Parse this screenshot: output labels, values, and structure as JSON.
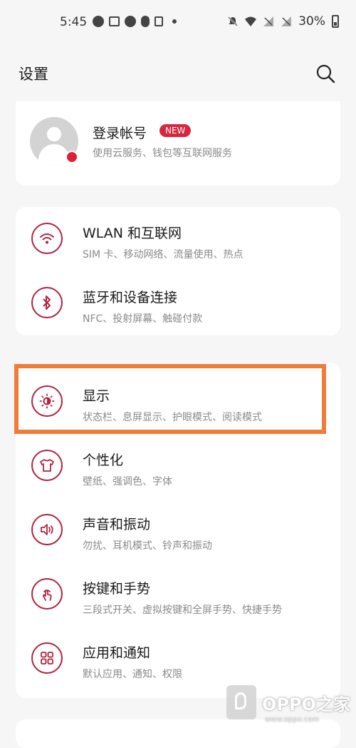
{
  "status_bar": {
    "time": "5:45",
    "battery": "30%",
    "icons": [
      "notification-icon",
      "image-icon",
      "notification-icon",
      "shield-icon",
      "copy-icon",
      "dot-icon",
      "mute-icon",
      "wifi-icon",
      "signal-off-icon",
      "signal-off-icon"
    ]
  },
  "header": {
    "title": "设置",
    "search_icon": "search-icon"
  },
  "account": {
    "title": "登录帐号",
    "badge": "NEW",
    "subtitle": "使用云服务、钱包等互联网服务"
  },
  "network_items": [
    {
      "title": "WLAN 和互联网",
      "subtitle": "SIM 卡、移动网络、流量使用、热点",
      "icon": "wifi-icon"
    },
    {
      "title": "蓝牙和设备连接",
      "subtitle": "NFC、投射屏幕、触碰付款",
      "icon": "bluetooth-icon"
    }
  ],
  "main_items": [
    {
      "title": "显示",
      "subtitle": "状态栏、息屏显示、护眼模式、阅读模式",
      "icon": "brightness-icon"
    },
    {
      "title": "个性化",
      "subtitle": "壁纸、强调色、字体",
      "icon": "tshirt-icon"
    },
    {
      "title": "声音和振动",
      "subtitle": "勿扰、耳机模式、铃声和振动",
      "icon": "speaker-icon"
    },
    {
      "title": "按键和手势",
      "subtitle": "三段式开关、虚拟按键和全屏手势、快捷手势",
      "icon": "gesture-icon"
    },
    {
      "title": "应用和通知",
      "subtitle": "默认应用、通知、权限",
      "icon": "apps-grid-icon"
    }
  ],
  "watermark": {
    "text": "OPPO之家",
    "url": "www.oppo.com"
  },
  "colors": {
    "accent": "#b0243f",
    "badge": "#d7263d",
    "highlight": "#f07c3a",
    "background": "#f6f6f6"
  }
}
